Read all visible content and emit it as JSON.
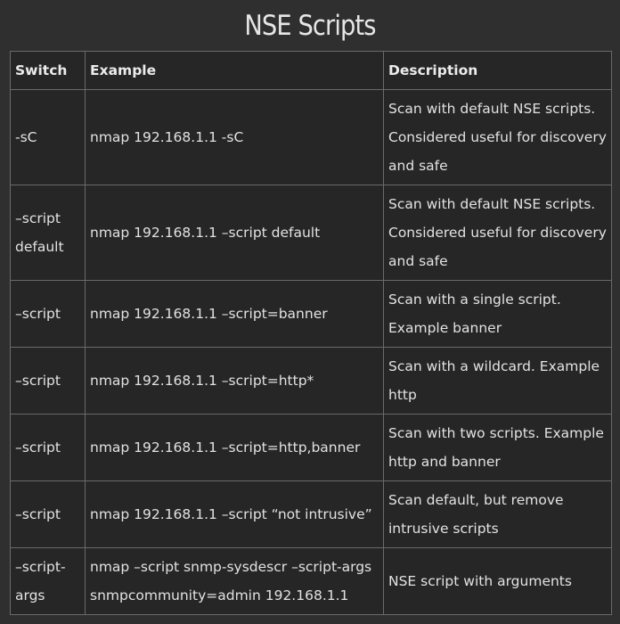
{
  "title": "NSE Scripts",
  "headers": {
    "switch": "Switch",
    "example": "Example",
    "description": "Description"
  },
  "rows": [
    {
      "switch": "-sC",
      "example": "nmap 192.168.1.1 -sC",
      "description": "Scan with default NSE scripts. Considered useful for discovery and safe"
    },
    {
      "switch": "–script default",
      "example": "nmap 192.168.1.1 –script default",
      "description": "Scan with default NSE scripts. Considered useful for discovery and safe"
    },
    {
      "switch": "–script",
      "example": "nmap 192.168.1.1 –script=banner",
      "description": "Scan with a single script. Example banner"
    },
    {
      "switch": "–script",
      "example": "nmap 192.168.1.1 –script=http*",
      "description": "Scan with a wildcard. Example http"
    },
    {
      "switch": "–script",
      "example": "nmap 192.168.1.1 –script=http,banner",
      "description": "Scan with two scripts. Example http and banner"
    },
    {
      "switch": "–script",
      "example": "nmap 192.168.1.1 –script “not intrusive”",
      "description": "Scan default, but remove intrusive scripts"
    },
    {
      "switch": "–script-args",
      "example": "nmap –script snmp-sysdescr –script-args snmpcommunity=admin 192.168.1.1",
      "description": "NSE script with arguments"
    }
  ]
}
